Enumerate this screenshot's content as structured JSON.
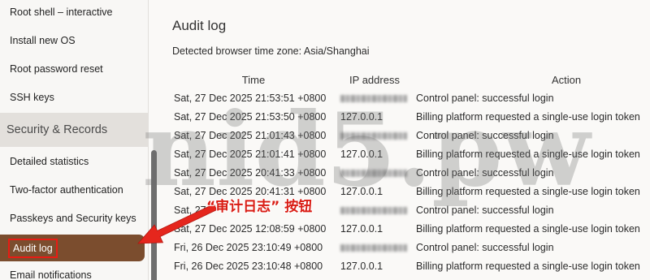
{
  "sidebar": {
    "items_top": [
      {
        "label": "Root shell – interactive"
      },
      {
        "label": "Install new OS"
      },
      {
        "label": "Root password reset"
      },
      {
        "label": "SSH keys"
      }
    ],
    "section": {
      "title": "Security & Records"
    },
    "items": [
      {
        "label": "Detailed statistics"
      },
      {
        "label": "Two-factor authentication"
      },
      {
        "label": "Passkeys and Security keys"
      },
      {
        "label": "Audit log",
        "selected": true
      },
      {
        "label": "Email notifications"
      }
    ]
  },
  "main": {
    "title": "Audit log",
    "timezone_text": "Detected browser time zone: Asia/Shanghai",
    "table": {
      "columns": [
        "Time",
        "IP address",
        "Action"
      ],
      "rows": [
        {
          "time": "Sat, 27 Dec 2025 21:53:51 +0800",
          "ip_blurred": true,
          "action": "Control panel: successful login"
        },
        {
          "time": "Sat, 27 Dec 2025 21:53:50 +0800",
          "ip": "127.0.0.1",
          "action": "Billing platform requested a single-use login token"
        },
        {
          "time": "Sat, 27 Dec 2025 21:01:43 +0800",
          "ip_blurred": true,
          "action": "Control panel: successful login"
        },
        {
          "time": "Sat, 27 Dec 2025 21:01:41 +0800",
          "ip": "127.0.0.1",
          "action": "Billing platform requested a single-use login token"
        },
        {
          "time": "Sat, 27 Dec 2025 20:41:33 +0800",
          "ip_blurred": true,
          "action": "Control panel: successful login"
        },
        {
          "time": "Sat, 27 Dec 2025 20:41:31 +0800",
          "ip": "127.0.0.1",
          "action": "Billing platform requested a single-use login token"
        },
        {
          "time": "Sat, 27",
          "ip_blurred": true,
          "action": "Control panel: successful login"
        },
        {
          "time": "Sat, 27 Dec 2025 12:08:59 +0800",
          "ip": "127.0.0.1",
          "action": "Billing platform requested a single-use login token"
        },
        {
          "time": "Fri, 26 Dec 2025 23:10:49 +0800",
          "ip_blurred": true,
          "action": "Control panel: successful login"
        },
        {
          "time": "Fri, 26 Dec 2025 23:10:48 +0800",
          "ip": "127.0.0.1",
          "action": "Billing platform requested a single-use login token"
        }
      ]
    }
  },
  "annotation": {
    "text": "“审计日志” 按钮"
  },
  "watermark": "nid5.pw",
  "colors": {
    "selected_bg": "#7b4d2e",
    "section_bg": "#e3e0dc",
    "annotation": "#d91c14",
    "highlight_border": "#e81c14",
    "arrow": "#e5261d"
  }
}
